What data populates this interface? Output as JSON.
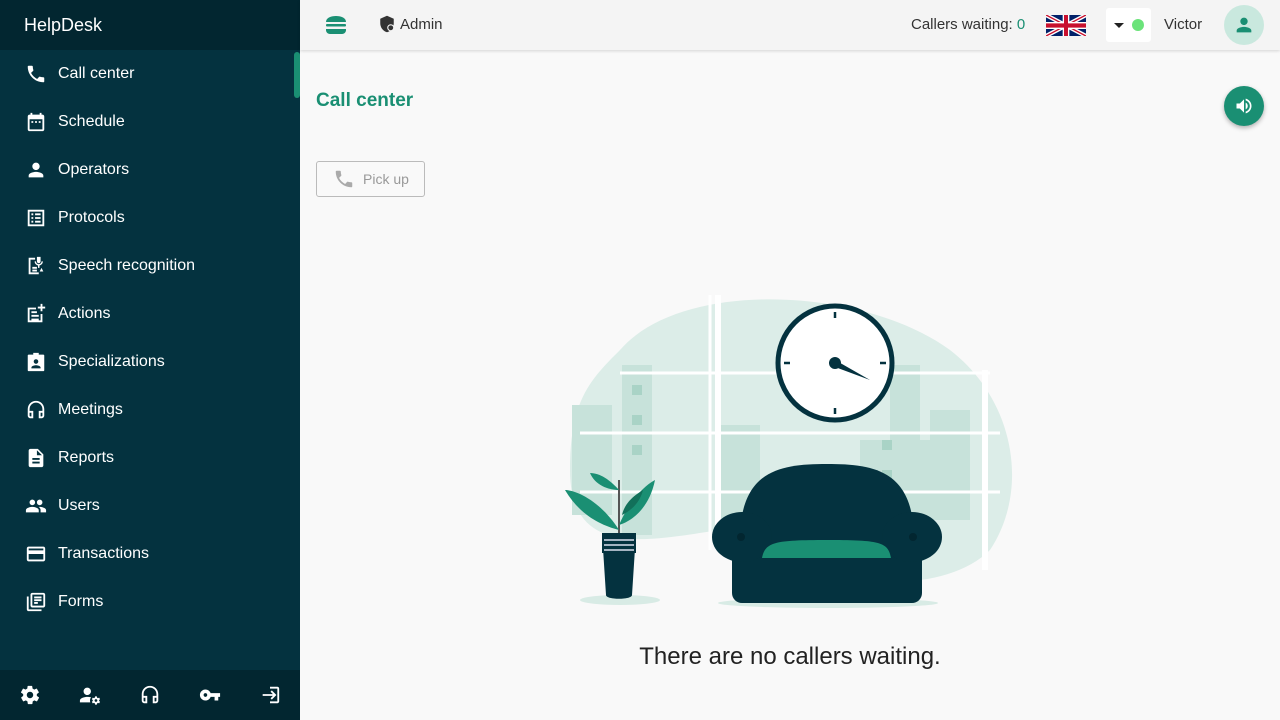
{
  "app": {
    "title": "HelpDesk"
  },
  "sidebar": {
    "items": [
      {
        "label": "Call center",
        "icon": "phone-icon"
      },
      {
        "label": "Schedule",
        "icon": "calendar-icon"
      },
      {
        "label": "Operators",
        "icon": "person-icon"
      },
      {
        "label": "Protocols",
        "icon": "list-icon"
      },
      {
        "label": "Speech recognition",
        "icon": "mic-document-icon"
      },
      {
        "label": "Actions",
        "icon": "note-add-icon"
      },
      {
        "label": "Specializations",
        "icon": "badge-icon"
      },
      {
        "label": "Meetings",
        "icon": "headset-icon"
      },
      {
        "label": "Reports",
        "icon": "document-icon"
      },
      {
        "label": "Users",
        "icon": "people-icon"
      },
      {
        "label": "Transactions",
        "icon": "credit-card-icon"
      },
      {
        "label": "Forms",
        "icon": "forms-icon"
      }
    ],
    "footer_icons": [
      "settings-icon",
      "user-settings-icon",
      "headset-icon",
      "key-icon",
      "logout-icon"
    ]
  },
  "topbar": {
    "menu_icon": "burger-icon",
    "role_label": "Admin",
    "callers_label": "Callers waiting:",
    "callers_count": "0",
    "language_flag": "uk-flag-icon",
    "status_color": "#6be37a",
    "username": "Victor"
  },
  "main": {
    "title": "Call center",
    "pickup_label": "Pick up",
    "empty_message": "There are no callers waiting."
  },
  "colors": {
    "sidebar_bg": "#04323f",
    "accent": "#1a8f73",
    "page_bg": "#f9f9f9"
  }
}
